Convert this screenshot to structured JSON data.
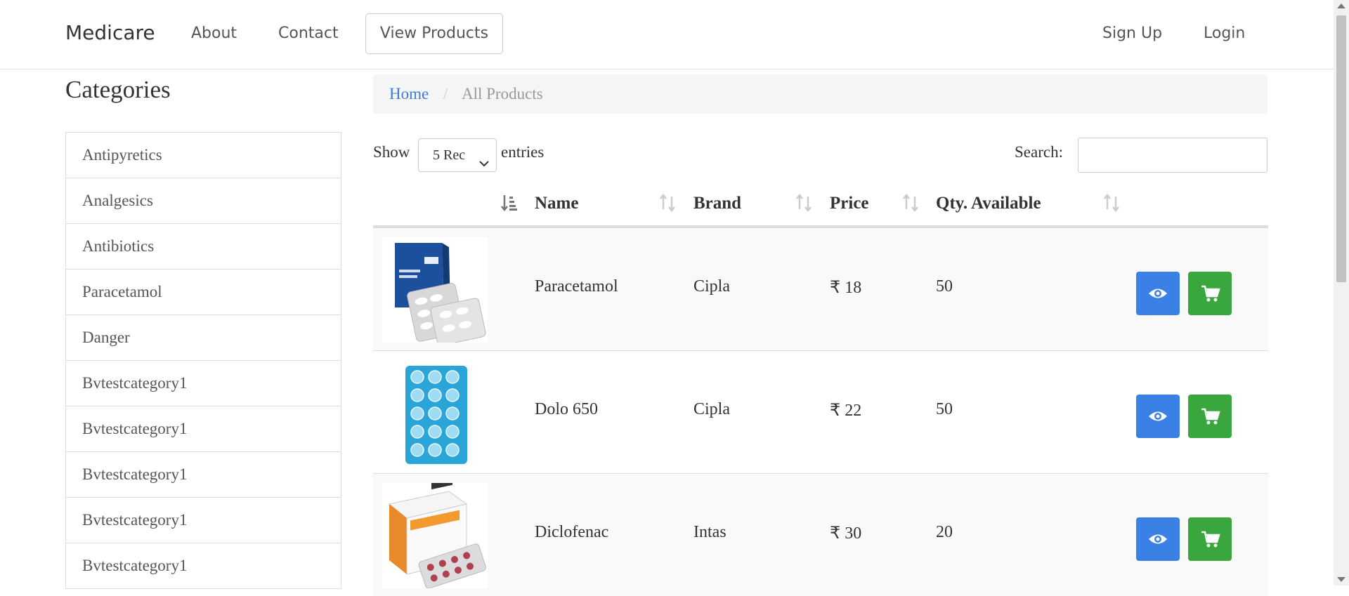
{
  "navbar": {
    "brand": "Medicare",
    "about": "About",
    "contact": "Contact",
    "view_products": "View Products",
    "sign_up": "Sign Up",
    "login": "Login"
  },
  "sidebar": {
    "title": "Categories",
    "items": [
      "Antipyretics",
      "Analgesics",
      "Antibiotics",
      "Paracetamol",
      "Danger",
      "Bvtestcategory1",
      "Bvtestcategory1",
      "Bvtestcategory1",
      "Bvtestcategory1",
      "Bvtestcategory1"
    ]
  },
  "breadcrumb": {
    "home": "Home",
    "separator": "/",
    "current": "All Products"
  },
  "table_controls": {
    "show_label": "Show",
    "entries_selected": "5 Rec",
    "entries_label": "entries",
    "search_label": "Search:",
    "search_value": ""
  },
  "table": {
    "headers": [
      "Name",
      "Brand",
      "Price",
      "Qty. Available"
    ],
    "rows": [
      {
        "image": "paracetamol-box-image",
        "name": "Paracetamol",
        "brand": "Cipla",
        "price": "₹ 18",
        "qty": "50"
      },
      {
        "image": "dolo-650-strip-image",
        "name": "Dolo 650",
        "brand": "Cipla",
        "price": "₹ 22",
        "qty": "50"
      },
      {
        "image": "diclofenac-box-image",
        "name": "Diclofenac",
        "brand": "Intas",
        "price": "₹ 30",
        "qty": "20"
      }
    ]
  },
  "icons": {
    "view": "eye-icon",
    "cart": "cart-icon",
    "sort": "sort-icon"
  },
  "colors": {
    "view_button": "#3b80e5",
    "cart_button": "#3aa63e",
    "link": "#3b7ddd"
  }
}
